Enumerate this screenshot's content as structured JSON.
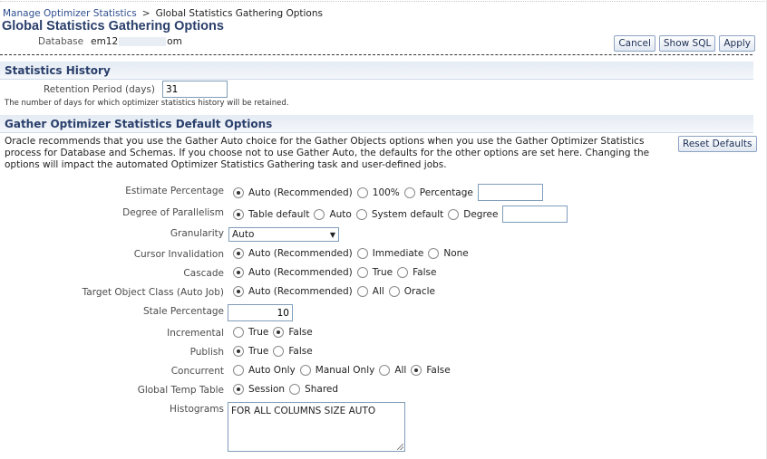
{
  "breadcrumb": {
    "parent_label": "Manage Optimizer Statistics",
    "separator": ">",
    "current_label": "Global Statistics Gathering Options"
  },
  "page_title": "Global Statistics Gathering Options",
  "database": {
    "label": "Database",
    "value_prefix": "em12",
    "value_suffix": "om"
  },
  "actions": {
    "cancel_label": "Cancel",
    "show_sql_label": "Show SQL",
    "apply_label": "Apply"
  },
  "statistics_history": {
    "header": "Statistics History",
    "retention_label": "Retention Period (days)",
    "retention_value": "31",
    "help_text": "The number of days for which optimizer statistics history will be retained."
  },
  "gather_defaults": {
    "header": "Gather Optimizer Statistics Default Options",
    "description": "Oracle recommends that you use the Gather Auto choice for the Gather Objects options when you use the Gather Optimizer Statistics process for Database and Schemas. If you choose not to use Gather Auto, the defaults for the other options are set here. Changing the options will impact the automated Optimizer Statistics Gathering task and user-defined jobs.",
    "reset_label": "Reset Defaults",
    "estimate_percentage": {
      "label": "Estimate Percentage",
      "options": [
        "Auto (Recommended)",
        "100%",
        "Percentage"
      ],
      "selected": "Auto (Recommended)",
      "input_value": ""
    },
    "degree_of_parallelism": {
      "label": "Degree of Parallelism",
      "options": [
        "Table default",
        "Auto",
        "System default",
        "Degree"
      ],
      "selected": "Table default",
      "input_value": ""
    },
    "granularity": {
      "label": "Granularity",
      "selected_value": "Auto"
    },
    "cursor_invalidation": {
      "label": "Cursor Invalidation",
      "options": [
        "Auto (Recommended)",
        "Immediate",
        "None"
      ],
      "selected": "Auto (Recommended)"
    },
    "cascade": {
      "label": "Cascade",
      "options": [
        "Auto (Recommended)",
        "True",
        "False"
      ],
      "selected": "Auto (Recommended)"
    },
    "target_object_class": {
      "label": "Target Object Class (Auto Job)",
      "options": [
        "Auto (Recommended)",
        "All",
        "Oracle"
      ],
      "selected": "Auto (Recommended)"
    },
    "stale_percentage": {
      "label": "Stale Percentage",
      "value": "10"
    },
    "incremental": {
      "label": "Incremental",
      "options": [
        "True",
        "False"
      ],
      "selected": "False"
    },
    "publish": {
      "label": "Publish",
      "options": [
        "True",
        "False"
      ],
      "selected": "True"
    },
    "concurrent": {
      "label": "Concurrent",
      "options": [
        "Auto Only",
        "Manual Only",
        "All",
        "False"
      ],
      "selected": "False"
    },
    "global_temp_table": {
      "label": "Global Temp Table",
      "options": [
        "Session",
        "Shared"
      ],
      "selected": "Session"
    },
    "histograms": {
      "label": "Histograms",
      "value": "FOR ALL COLUMNS SIZE AUTO"
    }
  }
}
